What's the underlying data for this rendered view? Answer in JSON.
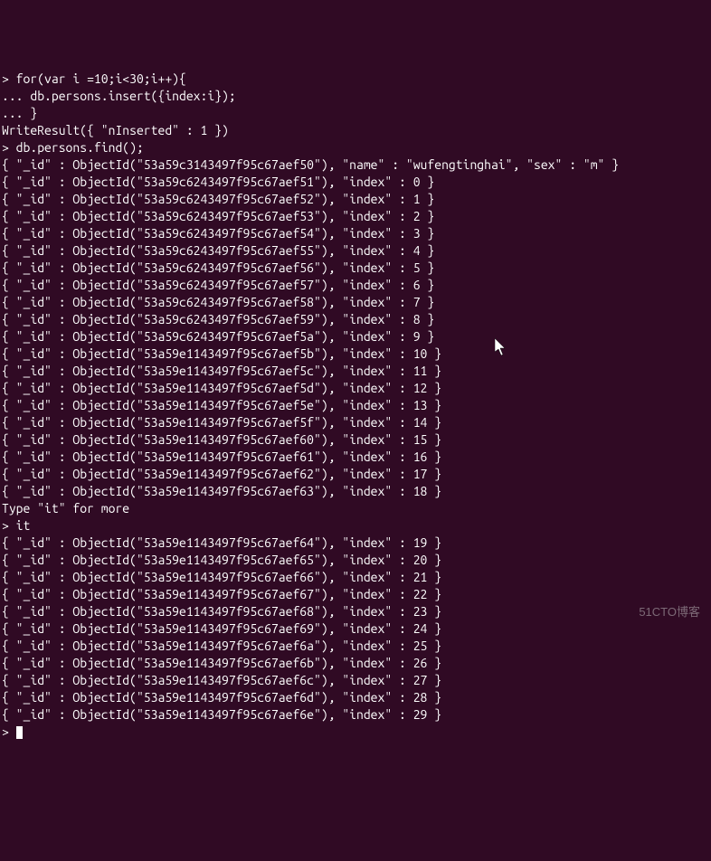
{
  "terminal": {
    "input1": "for(var i =10;i<30;i++){",
    "input2": "db.persons.insert({index:i});",
    "input3": "}",
    "writeResult": "WriteResult({ \"nInserted\" : 1 })",
    "command_find": "db.persons.find();",
    "typeit": "Type \"it\" for more",
    "it_cmd": "it",
    "first_row": "{ \"_id\" : ObjectId(\"53a59c3143497f95c67aef50\"), \"name\" : \"wufengtinghai\", \"sex\" : \"m\" }",
    "rows": [
      {
        "oid": "53a59c6243497f95c67aef51",
        "index": 0
      },
      {
        "oid": "53a59c6243497f95c67aef52",
        "index": 1
      },
      {
        "oid": "53a59c6243497f95c67aef53",
        "index": 2
      },
      {
        "oid": "53a59c6243497f95c67aef54",
        "index": 3
      },
      {
        "oid": "53a59c6243497f95c67aef55",
        "index": 4
      },
      {
        "oid": "53a59c6243497f95c67aef56",
        "index": 5
      },
      {
        "oid": "53a59c6243497f95c67aef57",
        "index": 6
      },
      {
        "oid": "53a59c6243497f95c67aef58",
        "index": 7
      },
      {
        "oid": "53a59c6243497f95c67aef59",
        "index": 8
      },
      {
        "oid": "53a59c6243497f95c67aef5a",
        "index": 9
      },
      {
        "oid": "53a59e1143497f95c67aef5b",
        "index": 10
      },
      {
        "oid": "53a59e1143497f95c67aef5c",
        "index": 11
      },
      {
        "oid": "53a59e1143497f95c67aef5d",
        "index": 12
      },
      {
        "oid": "53a59e1143497f95c67aef5e",
        "index": 13
      },
      {
        "oid": "53a59e1143497f95c67aef5f",
        "index": 14
      },
      {
        "oid": "53a59e1143497f95c67aef60",
        "index": 15
      },
      {
        "oid": "53a59e1143497f95c67aef61",
        "index": 16
      },
      {
        "oid": "53a59e1143497f95c67aef62",
        "index": 17
      },
      {
        "oid": "53a59e1143497f95c67aef63",
        "index": 18
      }
    ],
    "rows2": [
      {
        "oid": "53a59e1143497f95c67aef64",
        "index": 19
      },
      {
        "oid": "53a59e1143497f95c67aef65",
        "index": 20
      },
      {
        "oid": "53a59e1143497f95c67aef66",
        "index": 21
      },
      {
        "oid": "53a59e1143497f95c67aef67",
        "index": 22
      },
      {
        "oid": "53a59e1143497f95c67aef68",
        "index": 23
      },
      {
        "oid": "53a59e1143497f95c67aef69",
        "index": 24
      },
      {
        "oid": "53a59e1143497f95c67aef6a",
        "index": 25
      },
      {
        "oid": "53a59e1143497f95c67aef6b",
        "index": 26
      },
      {
        "oid": "53a59e1143497f95c67aef6c",
        "index": 27
      },
      {
        "oid": "53a59e1143497f95c67aef6d",
        "index": 28
      },
      {
        "oid": "53a59e1143497f95c67aef6e",
        "index": 29
      }
    ]
  },
  "watermark": "51CTO博客"
}
